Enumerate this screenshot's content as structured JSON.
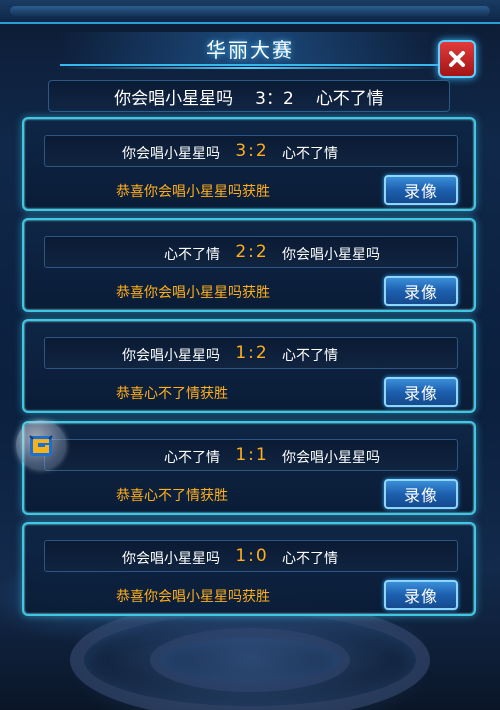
{
  "title": "华丽大赛",
  "summary": {
    "player_left": "你会唱小星星吗",
    "score": "3：2",
    "player_right": "心不了情"
  },
  "matches": [
    {
      "left": "你会唱小星星吗",
      "score": "3:2",
      "right": "心不了情",
      "result": "恭喜你会唱小星星吗获胜",
      "replay_label": "录像"
    },
    {
      "left": "心不了情",
      "score": "2:2",
      "right": "你会唱小星星吗",
      "result": "恭喜你会唱小星星吗获胜",
      "replay_label": "录像"
    },
    {
      "left": "你会唱小星星吗",
      "score": "1:2",
      "right": "心不了情",
      "result": "恭喜心不了情获胜",
      "replay_label": "录像"
    },
    {
      "left": "心不了情",
      "score": "1:1",
      "right": "你会唱小星星吗",
      "result": "恭喜心不了情获胜",
      "replay_label": "录像"
    },
    {
      "left": "你会唱小星星吗",
      "score": "1:0",
      "right": "心不了情",
      "result": "恭喜你会唱小星星吗获胜",
      "replay_label": "录像"
    }
  ],
  "colors": {
    "score": "#ffae1c",
    "winner_text": "#ffae1c",
    "card_border": "#3fc7e6",
    "close_button": "#d62a2a",
    "replay_button": "#1c5fae"
  },
  "icons": {
    "close": "close-icon",
    "floating": "game-logo-icon"
  }
}
